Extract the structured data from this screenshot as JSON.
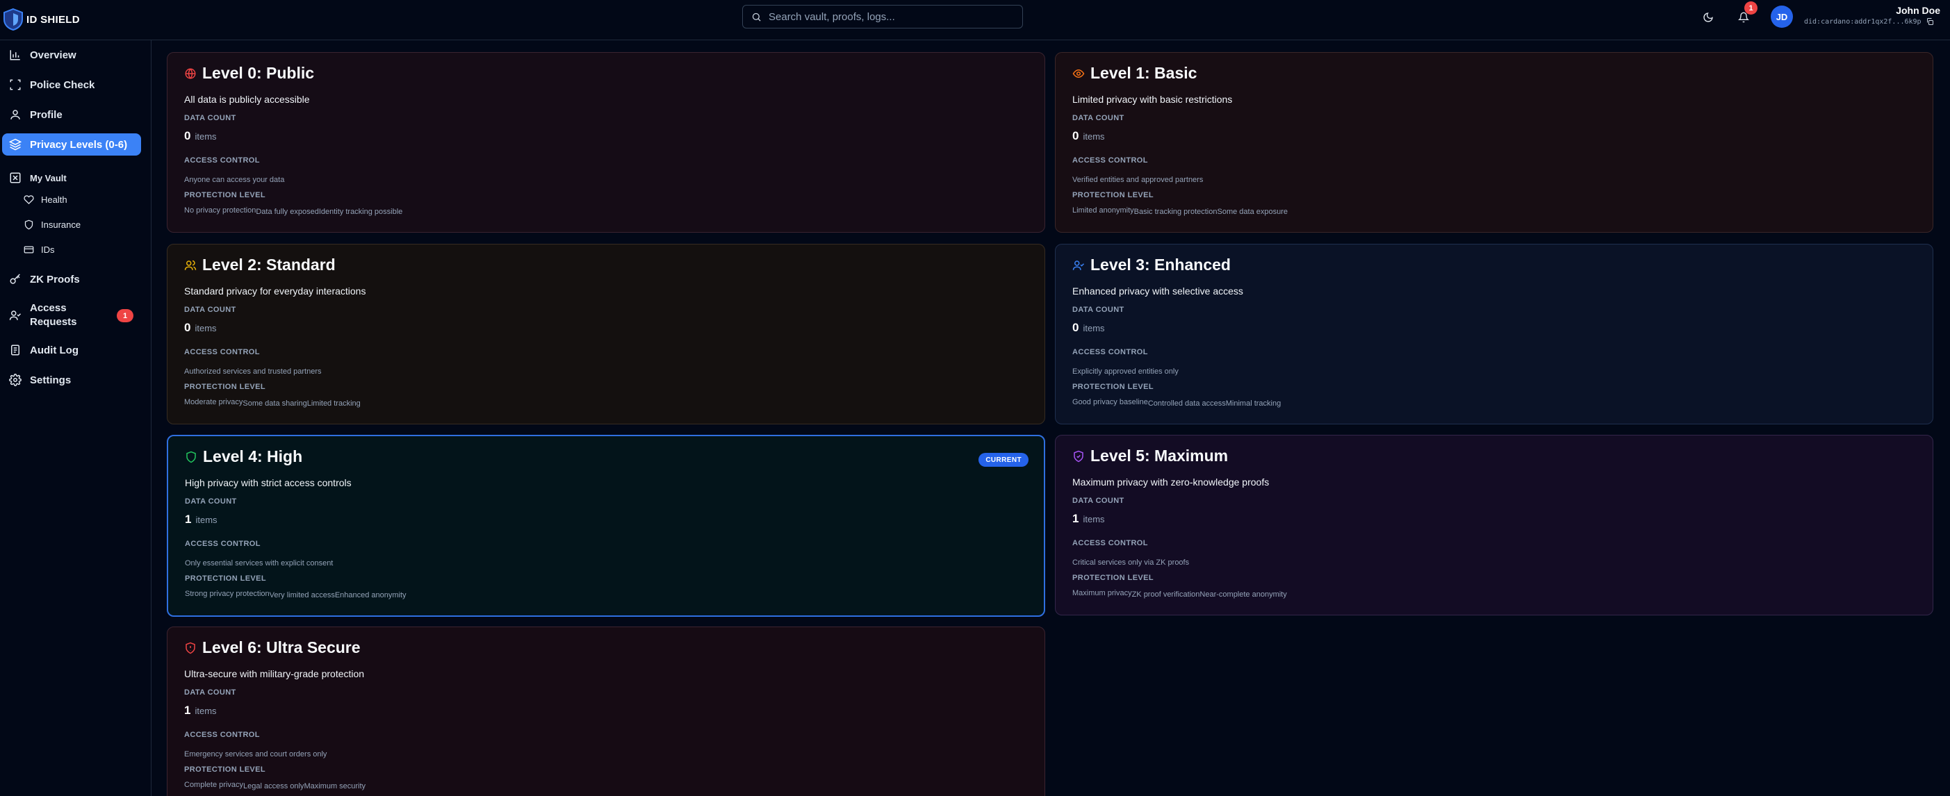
{
  "app": {
    "name": "ID SHIELD"
  },
  "search": {
    "placeholder": "Search vault, proofs, logs..."
  },
  "header": {
    "notification_count": "1",
    "avatar_initials": "JD",
    "user_name": "John Doe",
    "user_did": "did:cardano:addr1qx2f...6k9p"
  },
  "sidebar": {
    "items": [
      {
        "label": "Overview",
        "icon": "chart-icon"
      },
      {
        "label": "Police Check",
        "icon": "scan-icon"
      },
      {
        "label": "Profile",
        "icon": "user-icon"
      },
      {
        "label": "Privacy Levels (0-6)",
        "icon": "layers-icon",
        "active": true
      },
      {
        "label": "My Vault",
        "icon": "vault-icon"
      },
      {
        "label": "ZK Proofs",
        "icon": "key-icon"
      },
      {
        "label": "Access Requests",
        "icon": "user-check-icon",
        "badge": "1"
      },
      {
        "label": "Audit Log",
        "icon": "clipboard-icon"
      },
      {
        "label": "Settings",
        "icon": "gear-icon"
      }
    ],
    "vault_items": [
      {
        "label": "Health",
        "icon": "heart-icon"
      },
      {
        "label": "Insurance",
        "icon": "shield-icon"
      },
      {
        "label": "IDs",
        "icon": "card-icon"
      }
    ]
  },
  "labels": {
    "data_count": "DATA COUNT",
    "access_control": "ACCESS CONTROL",
    "protection_level": "PROTECTION LEVEL",
    "items": "items",
    "current": "CURRENT"
  },
  "levels": [
    {
      "title": "Level 0: Public",
      "description": "All data is publicly accessible",
      "count": "0",
      "access": "Anyone can access your data",
      "protection": [
        "No privacy protection",
        "Data fully exposed",
        "Identity tracking possible"
      ],
      "color": "#ef4444",
      "icon": "globe-icon"
    },
    {
      "title": "Level 1: Basic",
      "description": "Limited privacy with basic restrictions",
      "count": "0",
      "access": "Verified entities and approved partners",
      "protection": [
        "Limited anonymity",
        "Basic tracking protection",
        "Some data exposure"
      ],
      "color": "#f97316",
      "icon": "eye-icon"
    },
    {
      "title": "Level 2: Standard",
      "description": "Standard privacy for everyday interactions",
      "count": "0",
      "access": "Authorized services and trusted partners",
      "protection": [
        "Moderate privacy",
        "Some data sharing",
        "Limited tracking"
      ],
      "color": "#eab308",
      "icon": "users-icon"
    },
    {
      "title": "Level 3: Enhanced",
      "description": "Enhanced privacy with selective access",
      "count": "0",
      "access": "Explicitly approved entities only",
      "protection": [
        "Good privacy baseline",
        "Controlled data access",
        "Minimal tracking"
      ],
      "color": "#3b82f6",
      "icon": "user-check-icon"
    },
    {
      "title": "Level 4: High",
      "description": "High privacy with strict access controls",
      "count": "1",
      "access": "Only essential services with explicit consent",
      "protection": [
        "Strong privacy protection",
        "Very limited access",
        "Enhanced anonymity"
      ],
      "color": "#22c55e",
      "icon": "shield-icon",
      "current": true
    },
    {
      "title": "Level 5: Maximum",
      "description": "Maximum privacy with zero-knowledge proofs",
      "count": "1",
      "access": "Critical services only via ZK proofs",
      "protection": [
        "Maximum privacy",
        "ZK proof verification",
        "Near-complete anonymity"
      ],
      "color": "#a855f7",
      "icon": "shield-check-icon"
    },
    {
      "title": "Level 6: Ultra Secure",
      "description": "Ultra-secure with military-grade protection",
      "count": "1",
      "access": "Emergency services and court orders only",
      "protection": [
        "Complete privacy",
        "Legal access only",
        "Maximum security"
      ],
      "color": "#ef4444",
      "icon": "shield-alert-icon"
    }
  ]
}
